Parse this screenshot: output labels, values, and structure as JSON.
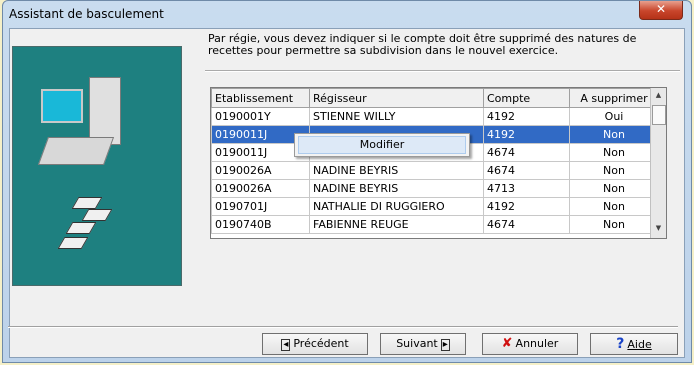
{
  "window": {
    "title": "Assistant de basculement",
    "close_glyph": "✕"
  },
  "description": "Par régie, vous devez indiquer si le compte doit être supprimé des natures de recettes pour permettre sa subdivision dans le nouvel exercice.",
  "table": {
    "columns": [
      "Etablissement",
      "Régisseur",
      "Compte",
      "A supprimer"
    ],
    "rows": [
      {
        "etab": "0190001Y",
        "regisseur": "STIENNE WILLY",
        "compte": "4192",
        "supprimer": "Oui"
      },
      {
        "etab": "0190011J",
        "regisseur": "",
        "compte": "4192",
        "supprimer": "Non"
      },
      {
        "etab": "0190011J",
        "regisseur": "FABIENNE REUGE",
        "compte": "4674",
        "supprimer": "Non"
      },
      {
        "etab": "0190026A",
        "regisseur": "NADINE BEYRIS",
        "compte": "4674",
        "supprimer": "Non"
      },
      {
        "etab": "0190026A",
        "regisseur": "NADINE BEYRIS",
        "compte": "4713",
        "supprimer": "Non"
      },
      {
        "etab": "0190701J",
        "regisseur": "NATHALIE DI RUGGIERO",
        "compte": "4192",
        "supprimer": "Non"
      },
      {
        "etab": "0190740B",
        "regisseur": "FABIENNE REUGE",
        "compte": "4674",
        "supprimer": "Non"
      }
    ],
    "selected_row": 1
  },
  "context_menu": {
    "items": [
      "Modifier"
    ]
  },
  "buttons": {
    "previous": "Précédent",
    "next": "Suivant",
    "cancel": "Annuler",
    "help": "Aide"
  },
  "icons": {
    "previous": "arrow-left-icon",
    "next": "arrow-right-icon",
    "cancel": "red-x-icon",
    "help": "question-mark-icon"
  },
  "colors": {
    "sidebar": "#1e8080",
    "selection": "#316ac5",
    "close_button": "#c8452b"
  }
}
